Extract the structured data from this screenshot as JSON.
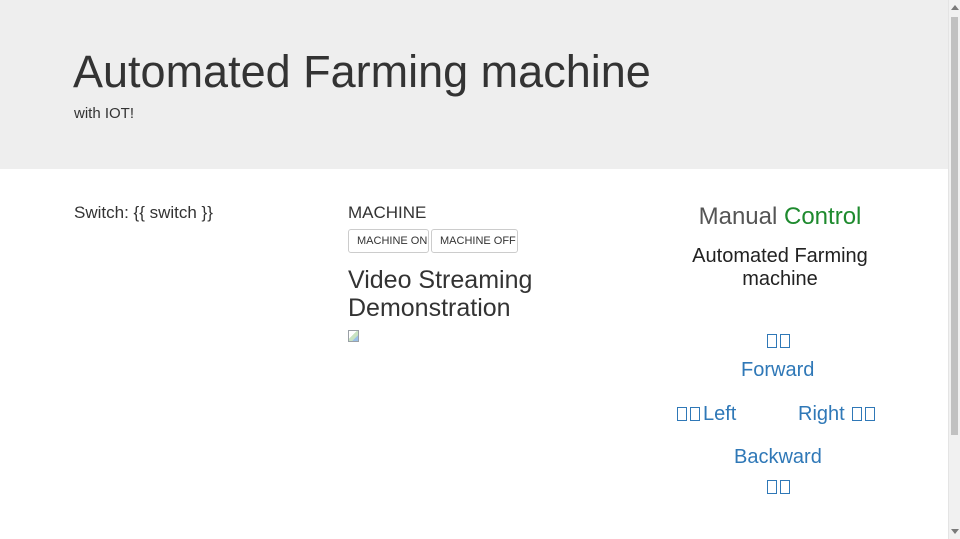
{
  "header": {
    "title": "Automated Farming machine",
    "subtitle": "with IOT!"
  },
  "switch_panel": {
    "text": "Switch: {{ switch }}"
  },
  "machine_panel": {
    "heading": "MACHINE",
    "on_label": "MACHINE ON",
    "off_label": "MACHINE OFF",
    "video_title": "Video Streaming Demonstration",
    "video_image": "broken-image-icon"
  },
  "control_panel": {
    "heading_part1": "Manual",
    "heading_part2": "Control",
    "heading_part2_color": "#1e8a2e",
    "subtitle": "Automated Farming machine",
    "forward_label": "Forward",
    "left_label": "Left",
    "right_label": "Right",
    "backward_label": "Backward",
    "link_color": "#2f78b7"
  },
  "colors": {
    "jumbotron_bg": "#eeeeee",
    "text": "#333333"
  }
}
